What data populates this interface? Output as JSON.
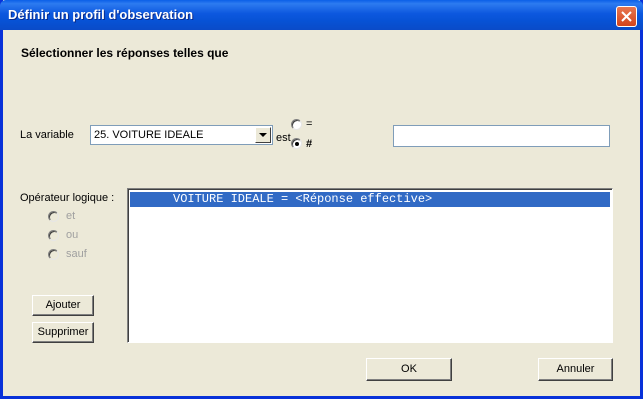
{
  "window": {
    "title": "Définir un profil d'observation"
  },
  "heading": "Sélectionner les réponses telles que",
  "variable": {
    "label": "La variable",
    "selected": "25. VOITURE IDEALE",
    "est_label": "est"
  },
  "comparison": {
    "options": [
      "=",
      "#"
    ],
    "selected": "#"
  },
  "value_field": {
    "value": ""
  },
  "operator": {
    "label": "Opérateur logique :",
    "options": [
      "et",
      "ou",
      "sauf"
    ]
  },
  "conditions": {
    "items": [
      "VOITURE IDEALE = <Réponse effective>"
    ]
  },
  "buttons": {
    "add": "Ajouter",
    "delete": "Supprimer",
    "ok": "OK",
    "cancel": "Annuler"
  }
}
